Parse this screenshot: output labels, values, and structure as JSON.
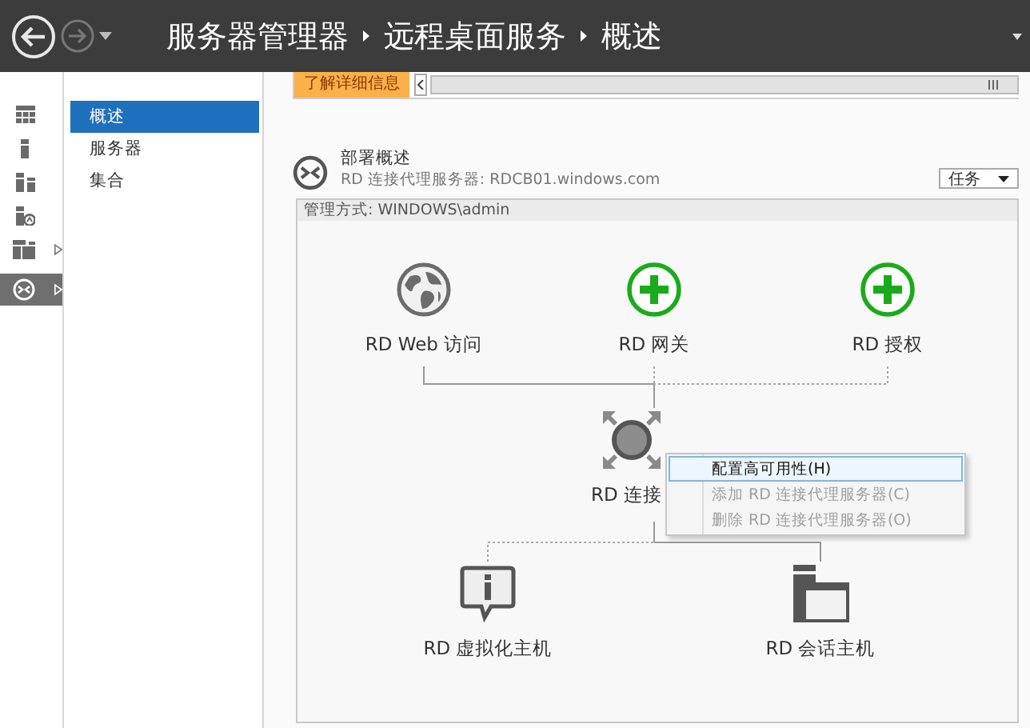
{
  "header": {
    "breadcrumb": [
      "服务器管理器",
      "远程桌面服务",
      "概述"
    ]
  },
  "icon_rail": [
    {
      "kind": "dashboard",
      "selected": false,
      "expandable": false
    },
    {
      "kind": "server",
      "selected": false,
      "expandable": false
    },
    {
      "kind": "servers",
      "selected": false,
      "expandable": false
    },
    {
      "kind": "role",
      "selected": false,
      "expandable": false
    },
    {
      "kind": "group",
      "selected": false,
      "expandable": true
    },
    {
      "kind": "remote",
      "selected": true,
      "expandable": true
    }
  ],
  "nav": [
    {
      "label": "概述",
      "selected": true
    },
    {
      "label": "服务器",
      "selected": false
    },
    {
      "label": "集合",
      "selected": false
    }
  ],
  "banner": {
    "link": "了解详细信息"
  },
  "deployment": {
    "title": "部署概述",
    "subtitle": "RD 连接代理服务器: RDCB01.windows.com",
    "tasks_button": "任务",
    "managed_by": "管理方式: WINDOWS\\admin",
    "nodes": [
      {
        "label": "RD Web 访问",
        "kind": "globe",
        "installed": true
      },
      {
        "label": "RD 网关",
        "kind": "add",
        "installed": false
      },
      {
        "label": "RD 授权",
        "kind": "add",
        "installed": false
      },
      {
        "label": "RD 连接",
        "kind": "broker",
        "installed": true
      },
      {
        "label": "RD 虚拟化主机",
        "kind": "info",
        "installed": false
      },
      {
        "label": "RD 会话主机",
        "kind": "session",
        "installed": true
      }
    ]
  },
  "context_menu": {
    "items": [
      {
        "label": "配置高可用性(H)",
        "disabled": false,
        "selected": true
      },
      {
        "label": "添加 RD 连接代理服务器(C)",
        "disabled": true,
        "selected": false
      },
      {
        "label": "删除 RD 连接代理服务器(O)",
        "disabled": true,
        "selected": false
      }
    ]
  }
}
